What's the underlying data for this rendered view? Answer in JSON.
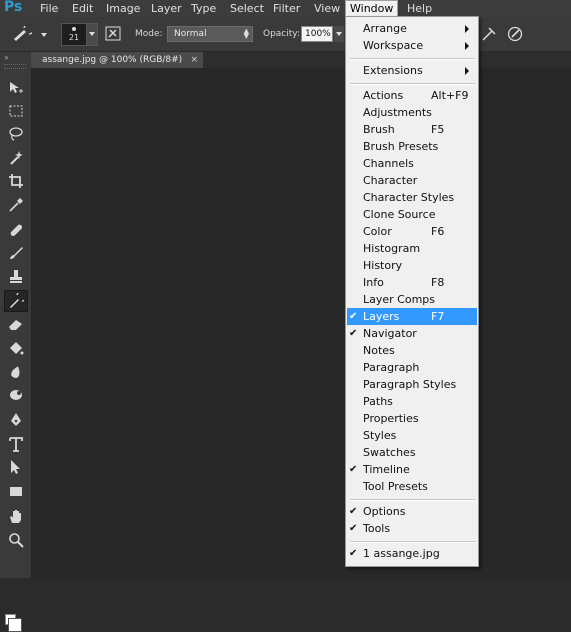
{
  "app": {
    "logo": "Ps"
  },
  "menubar": {
    "items": [
      "File",
      "Edit",
      "Image",
      "Layer",
      "Type",
      "Select",
      "Filter",
      "View",
      "Window",
      "Help"
    ],
    "active": "Window"
  },
  "options": {
    "brush_size": "21",
    "mode_label": "Mode:",
    "mode_value": "Normal",
    "opacity_label": "Opacity:",
    "opacity_value": "100%"
  },
  "document_tab": {
    "title": "assange.jpg @ 100% (RGB/8#)",
    "close_glyph": "×"
  },
  "toolbar": {
    "collapse_glyph": "»",
    "tools": [
      "move-tool",
      "marquee-tool",
      "lasso-tool",
      "magic-wand-tool",
      "crop-tool",
      "eyedropper-tool",
      "healing-brush-tool",
      "brush-tool",
      "clone-stamp-tool",
      "history-brush-tool",
      "eraser-tool",
      "paint-bucket-tool",
      "blur-tool",
      "dodge-tool",
      "pen-tool",
      "type-tool",
      "path-selection-tool",
      "rectangle-tool",
      "hand-tool",
      "zoom-tool"
    ],
    "selected_tool": "history-brush-tool",
    "foreground_color": "#ffffff",
    "background_color": "#ffffff"
  },
  "window_menu": {
    "top": [
      {
        "label": "Arrange",
        "submenu": true
      },
      {
        "label": "Workspace",
        "submenu": true
      }
    ],
    "extensions": {
      "label": "Extensions",
      "submenu": true
    },
    "panels": [
      {
        "label": "Actions",
        "shortcut": "Alt+F9",
        "checked": false
      },
      {
        "label": "Adjustments",
        "shortcut": "",
        "checked": false
      },
      {
        "label": "Brush",
        "shortcut": "F5",
        "checked": false
      },
      {
        "label": "Brush Presets",
        "shortcut": "",
        "checked": false
      },
      {
        "label": "Channels",
        "shortcut": "",
        "checked": false
      },
      {
        "label": "Character",
        "shortcut": "",
        "checked": false
      },
      {
        "label": "Character Styles",
        "shortcut": "",
        "checked": false
      },
      {
        "label": "Clone Source",
        "shortcut": "",
        "checked": false
      },
      {
        "label": "Color",
        "shortcut": "F6",
        "checked": false
      },
      {
        "label": "Histogram",
        "shortcut": "",
        "checked": false
      },
      {
        "label": "History",
        "shortcut": "",
        "checked": false
      },
      {
        "label": "Info",
        "shortcut": "F8",
        "checked": false
      },
      {
        "label": "Layer Comps",
        "shortcut": "",
        "checked": false
      },
      {
        "label": "Layers",
        "shortcut": "F7",
        "checked": true,
        "highlighted": true
      },
      {
        "label": "Navigator",
        "shortcut": "",
        "checked": true
      },
      {
        "label": "Notes",
        "shortcut": "",
        "checked": false
      },
      {
        "label": "Paragraph",
        "shortcut": "",
        "checked": false
      },
      {
        "label": "Paragraph Styles",
        "shortcut": "",
        "checked": false
      },
      {
        "label": "Paths",
        "shortcut": "",
        "checked": false
      },
      {
        "label": "Properties",
        "shortcut": "",
        "checked": false
      },
      {
        "label": "Styles",
        "shortcut": "",
        "checked": false
      },
      {
        "label": "Swatches",
        "shortcut": "",
        "checked": false
      },
      {
        "label": "Timeline",
        "shortcut": "",
        "checked": true
      },
      {
        "label": "Tool Presets",
        "shortcut": "",
        "checked": false
      }
    ],
    "bottom": [
      {
        "label": "Options",
        "checked": true
      },
      {
        "label": "Tools",
        "checked": true
      }
    ],
    "documents": [
      {
        "label": "1 assange.jpg",
        "checked": true
      }
    ],
    "check_glyph": "✔",
    "highlight_color": "#3399ff"
  }
}
